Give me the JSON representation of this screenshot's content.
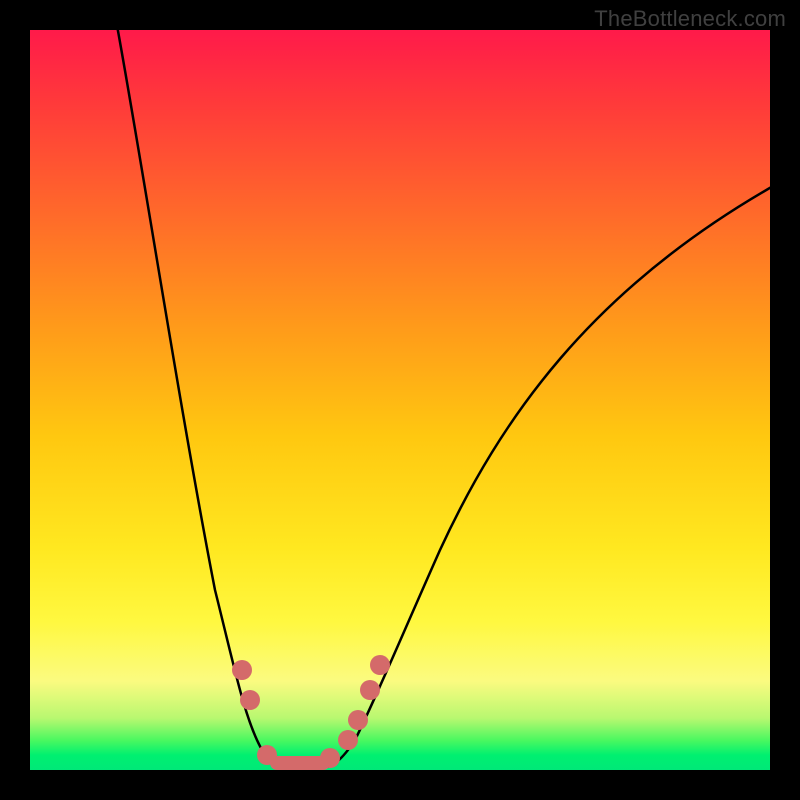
{
  "watermark": "TheBottleneck.com",
  "colors": {
    "background": "#000000",
    "gradient_top": "#ff1a4a",
    "gradient_mid": "#ffe820",
    "gradient_bottom": "#00e878",
    "curve": "#000000",
    "markers": "#d46a6a",
    "watermark_text": "#404040"
  },
  "chart_data": {
    "type": "line",
    "title": "",
    "xlabel": "",
    "ylabel": "",
    "xlim": [
      0,
      100
    ],
    "ylim": [
      0,
      100
    ],
    "grid": false,
    "legend_position": "none",
    "note": "Axes are unlabeled in the image; x/y values are estimated from normalized plot position (0–100).",
    "series": [
      {
        "name": "bottleneck-curve",
        "x": [
          12,
          16,
          20,
          24,
          27,
          30,
          33,
          36,
          40,
          44,
          50,
          58,
          68,
          80,
          92,
          100
        ],
        "y": [
          100,
          82,
          62,
          46,
          32,
          18,
          8,
          2,
          2,
          8,
          18,
          32,
          48,
          62,
          74,
          80
        ]
      }
    ],
    "annotations": [
      {
        "name": "optimal-region-markers",
        "description": "Pink markers near trough indicating balanced/optimal range",
        "points": [
          {
            "x": 29,
            "y": 14
          },
          {
            "x": 30,
            "y": 10
          },
          {
            "x": 32,
            "y": 3
          },
          {
            "x": 36,
            "y": 1
          },
          {
            "x": 40,
            "y": 2
          },
          {
            "x": 43,
            "y": 4
          },
          {
            "x": 44,
            "y": 7
          },
          {
            "x": 46,
            "y": 11
          },
          {
            "x": 47,
            "y": 14
          }
        ]
      }
    ]
  }
}
